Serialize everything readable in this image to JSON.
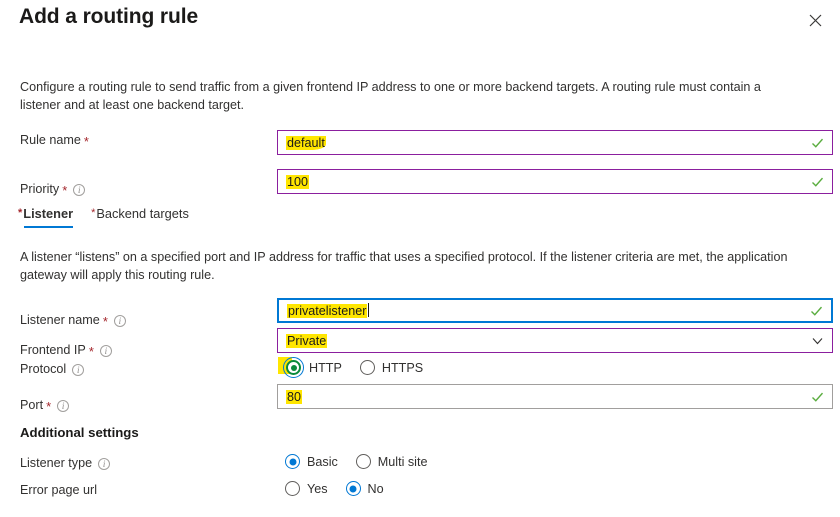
{
  "panel": {
    "title": "Add a routing rule",
    "close_icon": "close-icon",
    "intro": "Configure a routing rule to send traffic from a given frontend IP address to one or more backend targets. A routing rule must contain a listener and at least one backend target."
  },
  "rule": {
    "name_label": "Rule name",
    "name_required": "*",
    "name_value": "default",
    "priority_label": "Priority",
    "priority_required": "*",
    "priority_value": "100"
  },
  "tabs": [
    {
      "star": "*",
      "label": "Listener",
      "active": true
    },
    {
      "star": "*",
      "label": "Backend targets",
      "active": false
    }
  ],
  "listener": {
    "description": "A listener “listens” on a specified port and IP address for traffic that uses a specified protocol. If the listener criteria are met, the application gateway will apply this routing rule.",
    "name_label": "Listener name",
    "name_required": "*",
    "name_value": "privatelistener",
    "frontend_ip_label": "Frontend IP",
    "frontend_ip_required": "*",
    "frontend_ip_value": "Private",
    "protocol_label": "Protocol",
    "protocol_options": [
      "HTTP",
      "HTTPS"
    ],
    "protocol_selected": "HTTP",
    "port_label": "Port",
    "port_required": "*",
    "port_value": "80"
  },
  "additional": {
    "heading": "Additional settings",
    "listener_type_label": "Listener type",
    "listener_type_options": [
      "Basic",
      "Multi site"
    ],
    "listener_type_selected": "Basic",
    "error_page_label": "Error page url",
    "error_page_options": [
      "Yes",
      "No"
    ],
    "error_page_selected": "No"
  },
  "colors": {
    "accent": "#0078d4",
    "required": "#a4262c",
    "validated_border": "#8b1f9e",
    "valid_check": "#5aad3f",
    "highlight": "#ffe600",
    "green_radio": "#0a8a3c"
  }
}
